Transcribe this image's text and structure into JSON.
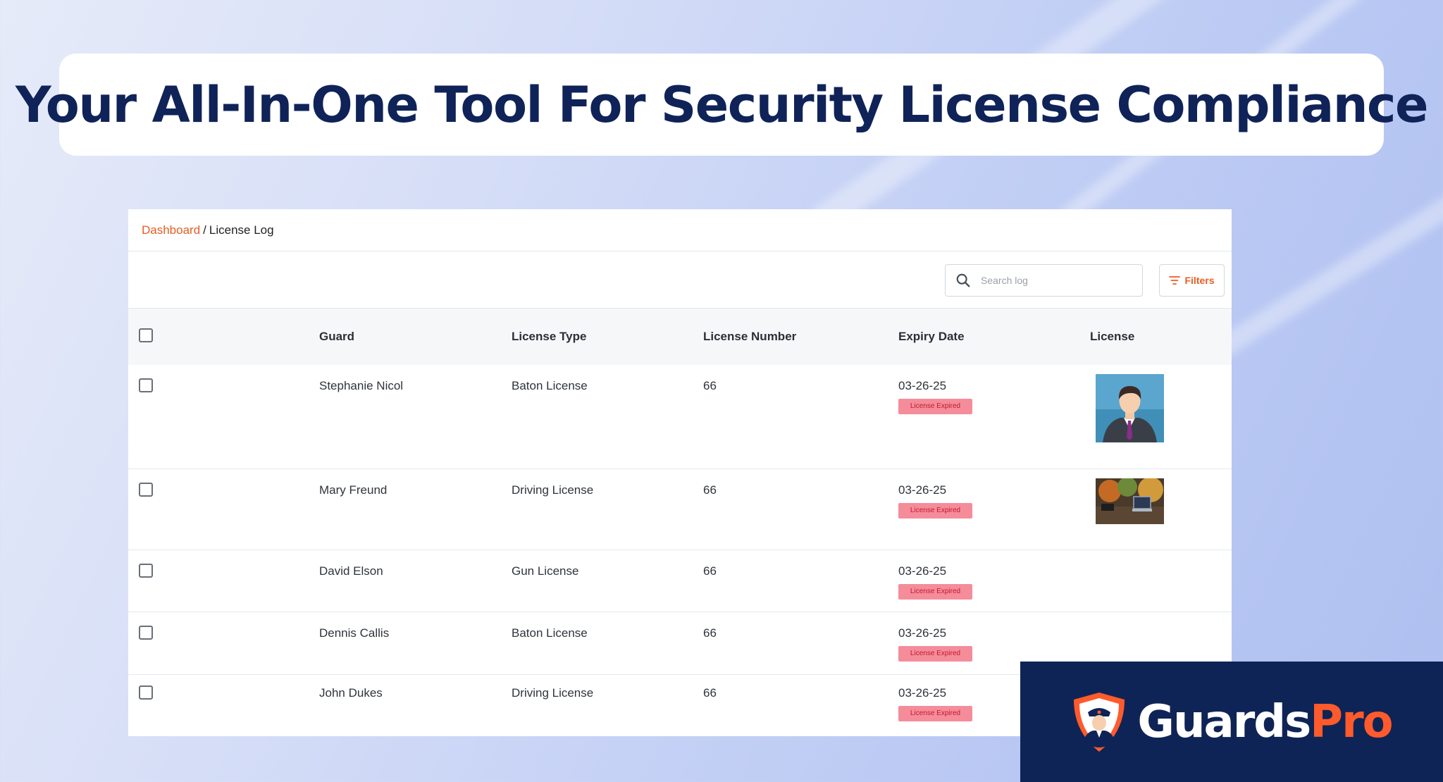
{
  "hero": {
    "title": "Your All-In-One Tool For Security License Compliance"
  },
  "breadcrumb": {
    "link": "Dashboard",
    "separator": "/",
    "current": "License Log"
  },
  "toolbar": {
    "search_placeholder": "Search log",
    "filters_label": "Filters"
  },
  "table": {
    "columns": [
      "Guard",
      "License Type",
      "License Number",
      "Expiry Date",
      "License"
    ],
    "rows": [
      {
        "guard": "Stephanie Nicol",
        "type": "Baton License",
        "number": "66",
        "expiry": "03-26-25",
        "status": "License Expired",
        "image": "avatar-photo-icon"
      },
      {
        "guard": "Mary Freund",
        "type": "Driving License",
        "number": "66",
        "expiry": "03-26-25",
        "status": "License Expired",
        "image": "desk-photo-icon"
      },
      {
        "guard": "David Elson",
        "type": "Gun License",
        "number": "66",
        "expiry": "03-26-25",
        "status": "License Expired",
        "image": ""
      },
      {
        "guard": "Dennis Callis",
        "type": "Baton License",
        "number": "66",
        "expiry": "03-26-25",
        "status": "License Expired",
        "image": ""
      },
      {
        "guard": "John Dukes",
        "type": "Driving License",
        "number": "66",
        "expiry": "03-26-25",
        "status": "License Expired",
        "image": ""
      }
    ]
  },
  "brand": {
    "name_part1": "Guards",
    "name_part2": "Pro",
    "shield_icon": "guard-shield-icon"
  },
  "colors": {
    "accent": "#e85d20",
    "navy": "#0f2358",
    "badge_bg": "#f58c9a",
    "badge_text": "#c3182d",
    "brand_orange": "#ff5a2c"
  }
}
